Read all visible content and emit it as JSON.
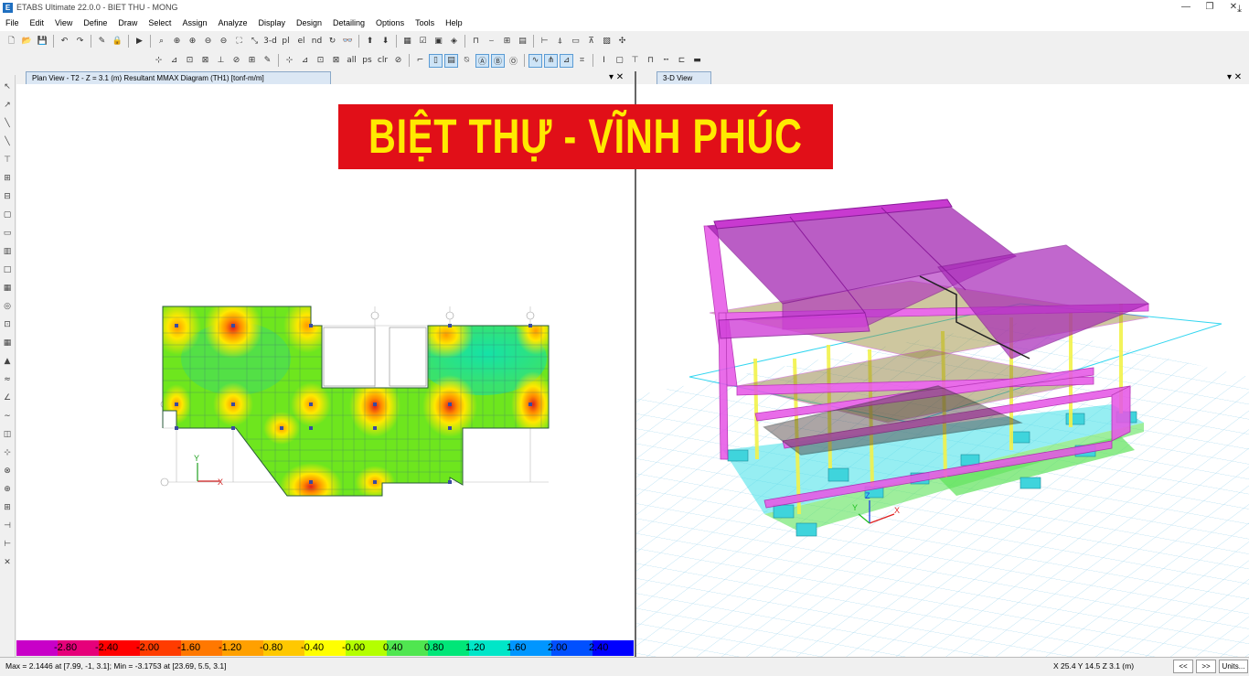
{
  "window": {
    "title": "ETABS Ultimate 22.0.0 - BIET THU - MONG",
    "app_icon": "E",
    "controls": [
      "—",
      "❐",
      "✕"
    ]
  },
  "menu": [
    "File",
    "Edit",
    "View",
    "Define",
    "Draw",
    "Select",
    "Assign",
    "Analyze",
    "Display",
    "Design",
    "Detailing",
    "Options",
    "Tools",
    "Help"
  ],
  "toolbar": {
    "row1_text": [
      "3-d",
      "pl",
      "el",
      "nd"
    ],
    "row2_text": [
      "all",
      "ps",
      "clr"
    ]
  },
  "plan_tab": {
    "label": "Plan View - T2 - Z = 3.1 (m)    Resultant MMAX Diagram    (TH1)  [tonf-m/m]",
    "controls": "▾ ✕"
  },
  "view3d_tab": {
    "label": "3-D View",
    "controls": "▾ ✕"
  },
  "banner": {
    "text": "BIỆT THỰ - VĨNH PHÚC",
    "bg": "#e10f18",
    "fg": "#ffea00"
  },
  "axis": {
    "x": "X",
    "y": "Y",
    "z": "Z"
  },
  "colorbar": {
    "labels": [
      "-2.80",
      "-2.40",
      "-2.00",
      "-1.60",
      "-1.20",
      "-0.80",
      "-0.40",
      "-0.00",
      "0.40",
      "0.80",
      "1.20",
      "1.60",
      "2.00",
      "2.40"
    ],
    "colors": [
      "#c800c8",
      "#e6007a",
      "#ff0000",
      "#ff3c00",
      "#ff7800",
      "#ffa000",
      "#ffc800",
      "#ffff00",
      "#b4ff00",
      "#50e650",
      "#00e678",
      "#00e6c8",
      "#0096ff",
      "#0050ff",
      "#0000ff"
    ]
  },
  "status": {
    "left": "Max = 2.1446 at [7.99, -1, 3.1];  Min = -3.1753 at [23.69, 5.5, 3.1]",
    "coords": "X 25.4  Y 14.5  Z 3.1 (m)",
    "prev": "<<",
    "next": ">>",
    "units": "Units..."
  }
}
